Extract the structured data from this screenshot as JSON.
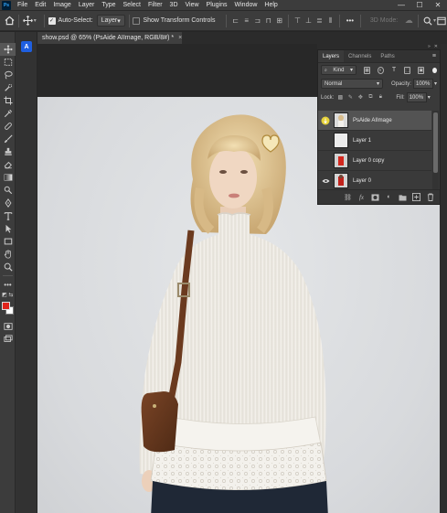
{
  "app": {
    "logo": "Ps",
    "menu": [
      "File",
      "Edit",
      "Image",
      "Layer",
      "Type",
      "Select",
      "Filter",
      "3D",
      "View",
      "Plugins",
      "Window",
      "Help"
    ],
    "window_controls": [
      "—",
      "☐",
      "✕"
    ]
  },
  "options_bar": {
    "auto_select_label": "Auto-Select:",
    "auto_select_checked": true,
    "auto_select_target": "Layer",
    "show_transform_label": "Show Transform Controls",
    "show_transform_checked": false,
    "more_label": "•••",
    "mode_3d_label": "3D Mode:"
  },
  "tools": [
    "move-icon",
    "marquee-icon",
    "lasso-icon",
    "quick-select-icon",
    "crop-icon",
    "eyedropper-icon",
    "healing-icon",
    "brush-icon",
    "clone-stamp-icon",
    "eraser-icon",
    "gradient-icon",
    "dodge-icon",
    "pen-icon",
    "type-icon",
    "path-select-icon",
    "rectangle-icon",
    "hand-icon",
    "zoom-icon",
    "more-tools-icon"
  ],
  "colors": {
    "foreground": "#e1231b",
    "background": "#ffffff",
    "ai_badge": "#1f5fe0"
  },
  "ai_badge_label": "A",
  "document": {
    "tab_title": "show.psd @ 65% (PsAide AIImage, RGB/8#) *",
    "close": "×"
  },
  "layers_panel": {
    "tabs": [
      "Layers",
      "Channels",
      "Paths"
    ],
    "active_tab": "Layers",
    "kind_label": "Kind",
    "blend_mode": "Normal",
    "opacity_label": "Opacity:",
    "opacity_value": "100%",
    "lock_label": "Lock:",
    "fill_label": "Fill:",
    "fill_value": "100%",
    "layers": [
      {
        "name": "PsAide AIImage",
        "visible": false,
        "selected": true
      },
      {
        "name": "Layer 1",
        "visible": false,
        "selected": false
      },
      {
        "name": "Layer 0 copy",
        "visible": false,
        "selected": false
      },
      {
        "name": "Layer 0",
        "visible": true,
        "selected": false
      }
    ],
    "footer_icons": [
      "link-icon",
      "fx-icon",
      "mask-icon",
      "adjustment-icon",
      "group-icon",
      "new-layer-icon",
      "trash-icon"
    ]
  }
}
